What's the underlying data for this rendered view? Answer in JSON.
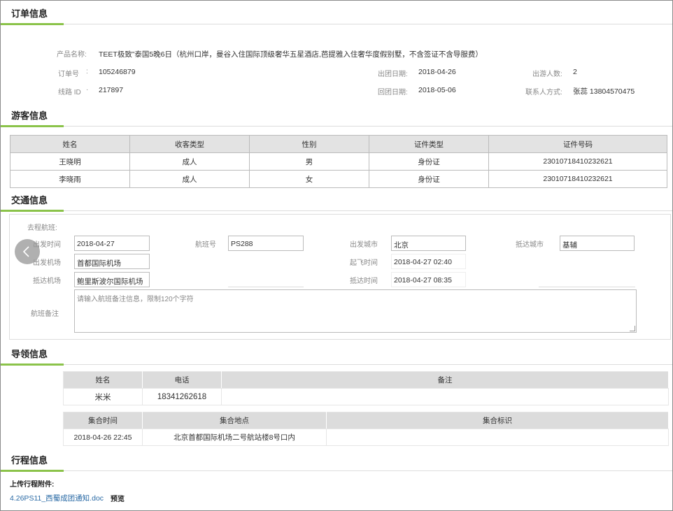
{
  "order": {
    "title": "订单信息",
    "product_label": "产品名称:",
    "product_value": "TEET极致”泰国5晚6日（杭州口岸，曼谷入住国际顶级奢华五星酒店,芭提雅入住奢华度假别墅，不含签证不含导服费）",
    "order_no_label": "订单号",
    "order_no_sep": ":",
    "order_no_value": "105246879",
    "route_label": "线路 ID",
    "route_sep": "·",
    "route_value": "217897",
    "depart_label": "出团日期:",
    "depart_value": "2018-04-26",
    "return_label": "回团日期:",
    "return_value": "2018-05-06",
    "people_label": "出游人数:",
    "people_value": "2",
    "contact_label": "联系人方式:",
    "contact_value": "张蕊 13804570475"
  },
  "tourists": {
    "title": "游客信息",
    "headers": [
      "姓名",
      "收客类型",
      "性别",
      "证件类型",
      "证件号码"
    ],
    "rows": [
      [
        "王晓明",
        "成人",
        "男",
        "身份证",
        "230107184102326​21"
      ],
      [
        "李晓雨",
        "成人",
        "女",
        "身份证",
        "230107184102326​21"
      ]
    ]
  },
  "traffic": {
    "title": "交通信息",
    "outbound_label": "去程航班:",
    "depart_time_label": "出发时间",
    "depart_time_value": "2018-04-27",
    "flight_no_label": "航班号",
    "flight_no_value": "PS288",
    "from_city_label": "出发城市",
    "from_city_value": "北京",
    "to_city_label": "抵达城市",
    "to_city_value": "基辅",
    "from_airport_label": "出发机场",
    "from_airport_value": "首都国际机场",
    "takeoff_label": "起飞时间",
    "takeoff_value": "2018-04-27 02:40",
    "to_airport_label": "抵达机场",
    "to_airport_value": "鲍里斯波尔国际机场",
    "arrive_label": "抵达时间",
    "arrive_value": "2018-04-27 08:35",
    "remark_label": "航班备注",
    "remark_placeholder": "请输入航班备注信息，限制120个字符"
  },
  "guide": {
    "title": "导领信息",
    "headers": [
      "姓名",
      "电话",
      "备注"
    ],
    "row": [
      "米米",
      "18341262618",
      ""
    ],
    "meet_headers": [
      "集合时间",
      "集合地点",
      "集合标识"
    ],
    "meet_row": [
      "2018-04-26 22:45",
      "北京首都国际机场二号航站楼8号口内",
      ""
    ]
  },
  "itinerary": {
    "title": "行程信息",
    "upload_label": "上传行程附件:",
    "file_name": "4.26PS11_西蜀成团通知.doc",
    "preview_label": "预览"
  },
  "colors": {
    "accent": "#8bc34a",
    "link": "#2a6aa5"
  }
}
